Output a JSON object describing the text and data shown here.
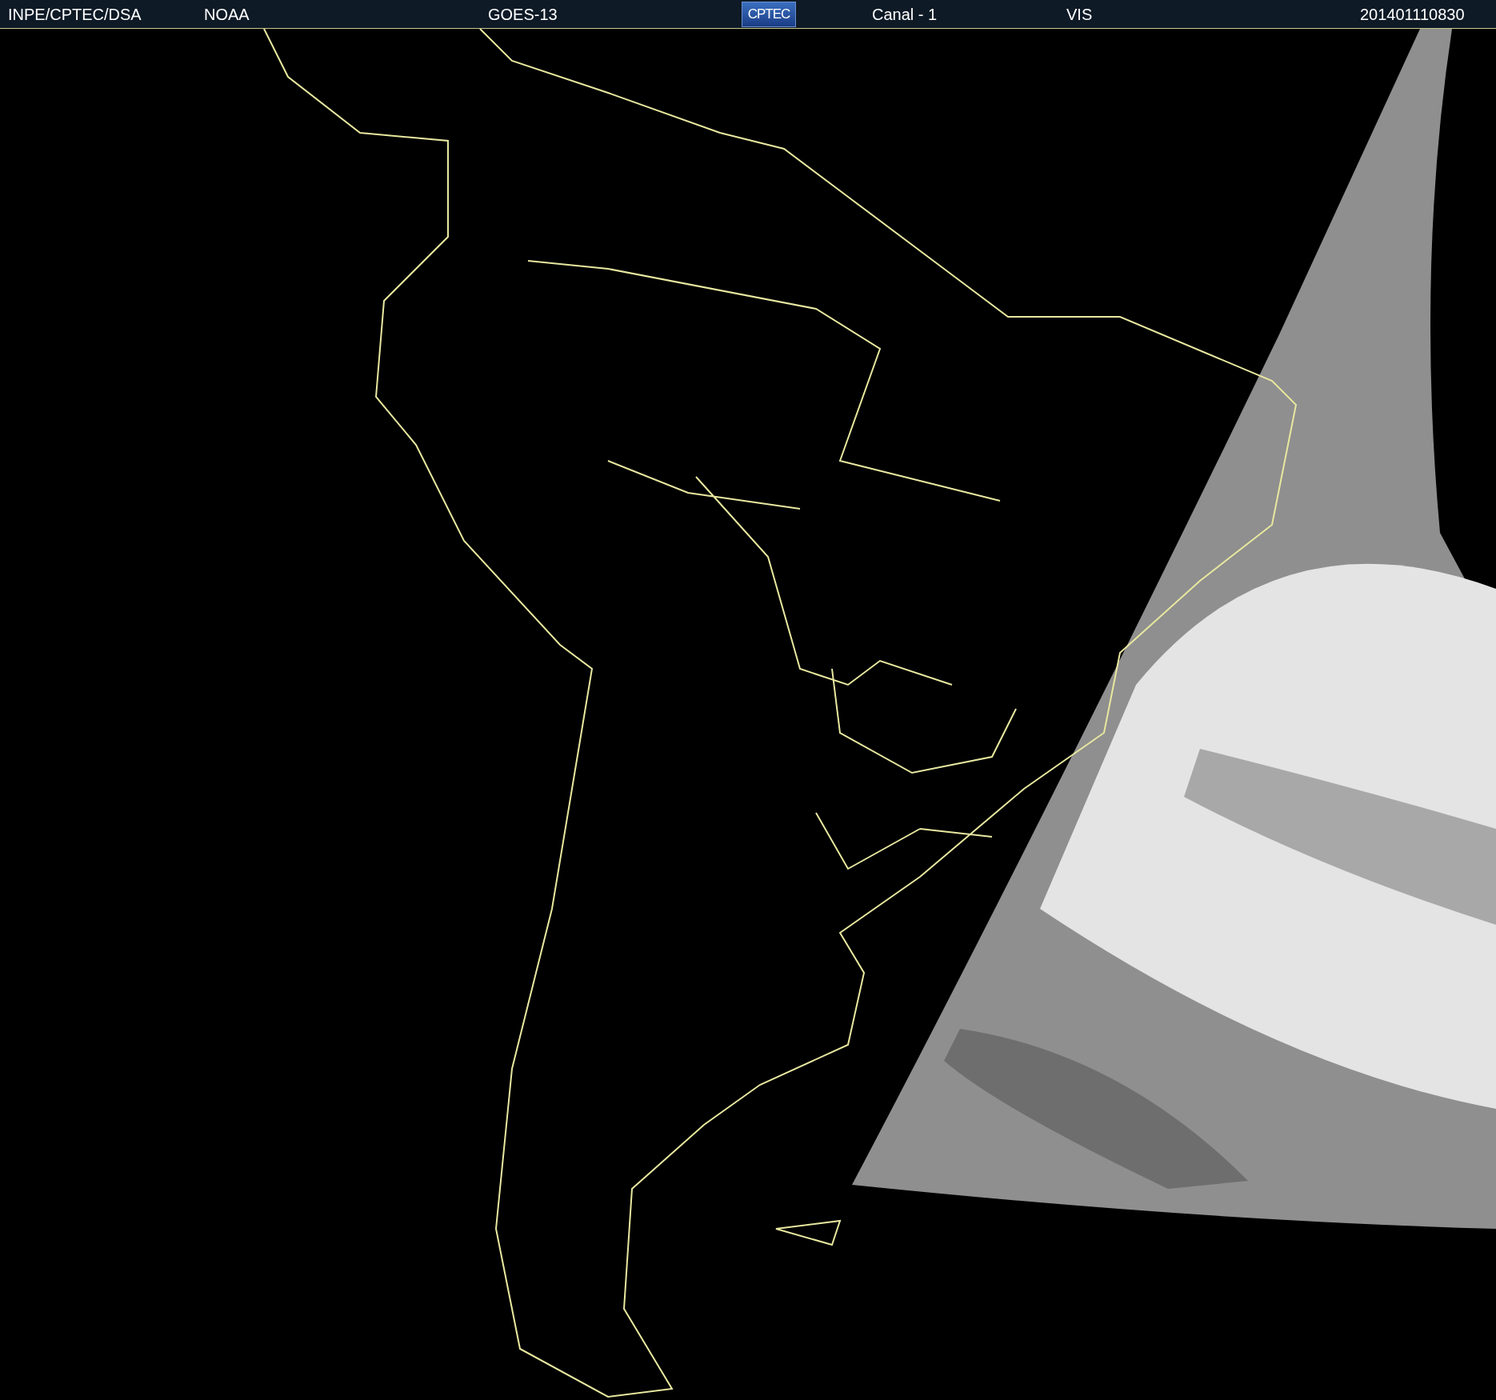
{
  "header": {
    "source": "INPE/CPTEC/DSA",
    "agency": "NOAA",
    "satellite": "GOES-13",
    "logo": "CPTEC",
    "channel": "Canal - 1",
    "band": "VIS",
    "timestamp": "201401110830"
  },
  "image": {
    "kind": "map-picture"
  }
}
